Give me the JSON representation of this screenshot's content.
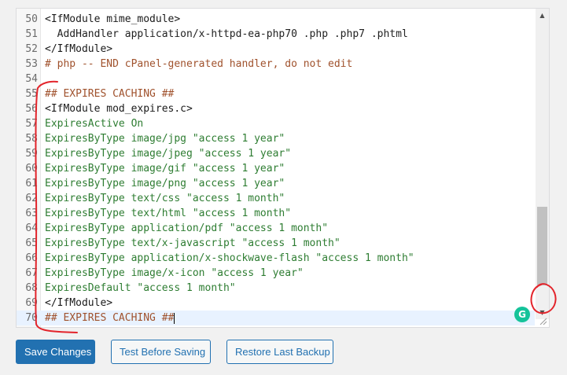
{
  "editor": {
    "lines": [
      {
        "num": "50",
        "text": "<IfModule mime_module>",
        "style": "tag"
      },
      {
        "num": "51",
        "text": "  AddHandler application/x-httpd-ea-php70 .php .php7 .phtml",
        "style": "plain"
      },
      {
        "num": "52",
        "text": "</IfModule>",
        "style": "tag"
      },
      {
        "num": "53",
        "text": "# php -- END cPanel-generated handler, do not edit",
        "style": "cmt"
      },
      {
        "num": "54",
        "text": "",
        "style": "plain"
      },
      {
        "num": "55",
        "text": "## EXPIRES CACHING ##",
        "style": "cmt"
      },
      {
        "num": "56",
        "text": "<IfModule mod_expires.c>",
        "style": "tag"
      },
      {
        "num": "57",
        "text": "ExpiresActive On",
        "style": "dir"
      },
      {
        "num": "58",
        "text": "ExpiresByType image/jpg \"access 1 year\"",
        "style": "dir"
      },
      {
        "num": "59",
        "text": "ExpiresByType image/jpeg \"access 1 year\"",
        "style": "dir"
      },
      {
        "num": "60",
        "text": "ExpiresByType image/gif \"access 1 year\"",
        "style": "dir"
      },
      {
        "num": "61",
        "text": "ExpiresByType image/png \"access 1 year\"",
        "style": "dir"
      },
      {
        "num": "62",
        "text": "ExpiresByType text/css \"access 1 month\"",
        "style": "dir"
      },
      {
        "num": "63",
        "text": "ExpiresByType text/html \"access 1 month\"",
        "style": "dir"
      },
      {
        "num": "64",
        "text": "ExpiresByType application/pdf \"access 1 month\"",
        "style": "dir"
      },
      {
        "num": "65",
        "text": "ExpiresByType text/x-javascript \"access 1 month\"",
        "style": "dir"
      },
      {
        "num": "66",
        "text": "ExpiresByType application/x-shockwave-flash \"access 1 month\"",
        "style": "dir"
      },
      {
        "num": "67",
        "text": "ExpiresByType image/x-icon \"access 1 year\"",
        "style": "dir"
      },
      {
        "num": "68",
        "text": "ExpiresDefault \"access 1 month\"",
        "style": "dir"
      },
      {
        "num": "69",
        "text": "</IfModule>",
        "style": "tag"
      },
      {
        "num": "70",
        "text": "## EXPIRES CACHING ##",
        "style": "cmt"
      }
    ],
    "active_line": "70",
    "grammarly_badge": "G",
    "scroll_position": 0.9
  },
  "buttons": {
    "save": "Save Changes",
    "test": "Test Before Saving",
    "restore": "Restore Last Backup"
  },
  "colors": {
    "primary_button": "#2271b1",
    "comment": "#a0522d",
    "directive": "#2e7d32",
    "annotation": "#e3242b",
    "grammarly": "#15c39a"
  }
}
